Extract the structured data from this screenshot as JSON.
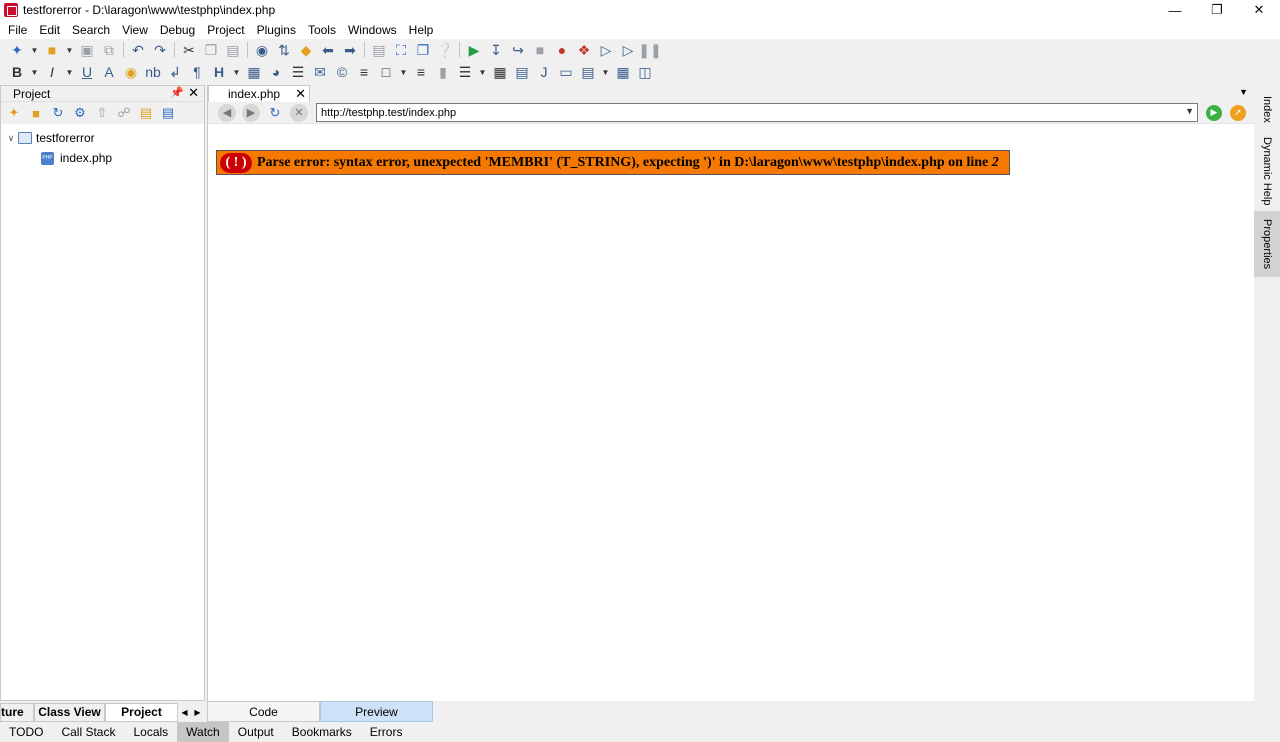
{
  "window": {
    "title": "testforerror - D:\\laragon\\www\\testphp\\index.php"
  },
  "menu": [
    "File",
    "Edit",
    "Search",
    "View",
    "Debug",
    "Project",
    "Plugins",
    "Tools",
    "Windows",
    "Help"
  ],
  "project_panel": {
    "title": "Project",
    "tree": [
      {
        "label": "testforerror"
      },
      {
        "label": "index.php"
      }
    ]
  },
  "editor": {
    "tab": "index.php",
    "url": "http://testphp.test/index.php",
    "error": {
      "icon": "( ! )",
      "text": "Parse error: syntax error, unexpected 'MEMBRI' (T_STRING), expecting ')' in D:\\laragon\\www\\testphp\\index.php on line",
      "line": "2",
      "color": "#f57900"
    },
    "bottom_tabs": [
      "Code",
      "Preview"
    ]
  },
  "right_rail": [
    "Index",
    "Dynamic Help",
    "Properties"
  ],
  "panel_tabs": [
    "ture",
    "Class View",
    "Project"
  ],
  "bottom_tabs": [
    "TODO",
    "Call Stack",
    "Locals",
    "Watch",
    "Output",
    "Bookmarks",
    "Errors"
  ]
}
